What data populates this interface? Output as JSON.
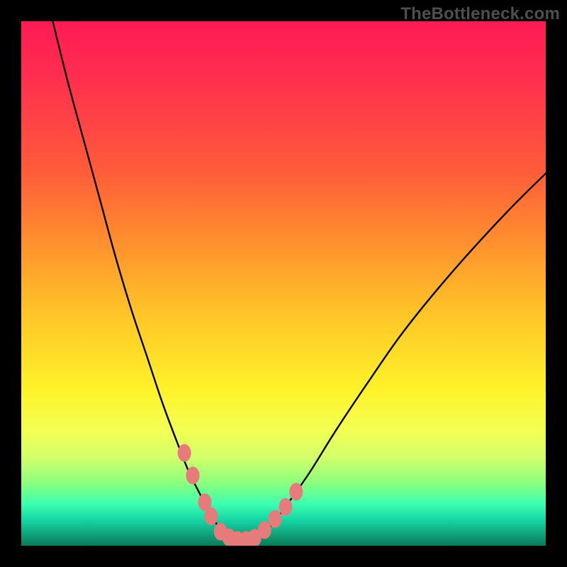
{
  "watermark": "TheBottleneck.com",
  "chart_data": {
    "type": "line",
    "title": "",
    "xlabel": "",
    "ylabel": "",
    "xlim": [
      0,
      100
    ],
    "ylim": [
      0,
      100
    ],
    "grid": false,
    "legend": false,
    "series": [
      {
        "name": "bottleneck-curve",
        "color": "#000000",
        "x": [
          6,
          9,
          12,
          15,
          18,
          21,
          24,
          27,
          30,
          32,
          34,
          35.5,
          37,
          38.5,
          40,
          42,
          44,
          46,
          48,
          51,
          55,
          60,
          66,
          73,
          82,
          92,
          100
        ],
        "y": [
          100,
          88,
          77,
          66,
          55,
          45,
          36,
          27,
          19,
          14,
          10,
          7,
          4.5,
          2.7,
          1.6,
          1.0,
          1.2,
          2.3,
          4.3,
          8.3,
          14,
          22,
          31,
          41,
          52,
          63,
          71
        ]
      }
    ],
    "markers": [
      {
        "name": "dot-left-upper",
        "x": 31.1,
        "y": 17.7,
        "color": "#e77b7b"
      },
      {
        "name": "dot-left-mid",
        "x": 32.7,
        "y": 13.4,
        "color": "#e77b7b"
      },
      {
        "name": "dot-left-low1",
        "x": 35.0,
        "y": 8.3,
        "color": "#e77b7b"
      },
      {
        "name": "dot-left-low2",
        "x": 36.2,
        "y": 5.6,
        "color": "#e77b7b"
      },
      {
        "name": "dot-bottom-1",
        "x": 38.0,
        "y": 2.7,
        "color": "#e77b7b"
      },
      {
        "name": "dot-bottom-2",
        "x": 39.6,
        "y": 1.6,
        "color": "#e77b7b"
      },
      {
        "name": "dot-bottom-3",
        "x": 41.2,
        "y": 1.1,
        "color": "#e77b7b"
      },
      {
        "name": "dot-bottom-4",
        "x": 42.9,
        "y": 1.1,
        "color": "#e77b7b"
      },
      {
        "name": "dot-bottom-5",
        "x": 44.5,
        "y": 1.5,
        "color": "#e77b7b"
      },
      {
        "name": "dot-right-low1",
        "x": 46.4,
        "y": 3.0,
        "color": "#e77b7b"
      },
      {
        "name": "dot-right-low2",
        "x": 48.4,
        "y": 5.1,
        "color": "#e77b7b"
      },
      {
        "name": "dot-right-mid",
        "x": 50.4,
        "y": 7.4,
        "color": "#e77b7b"
      },
      {
        "name": "dot-right-upper",
        "x": 52.4,
        "y": 10.3,
        "color": "#e77b7b"
      }
    ],
    "background_gradient": {
      "direction": "top-to-bottom",
      "stops": [
        {
          "pos": 0.0,
          "color": "#ff1b55"
        },
        {
          "pos": 0.28,
          "color": "#ff5a3a"
        },
        {
          "pos": 0.55,
          "color": "#ffc228"
        },
        {
          "pos": 0.7,
          "color": "#fff229"
        },
        {
          "pos": 0.88,
          "color": "#8cff7e"
        },
        {
          "pos": 0.95,
          "color": "#16d7a6"
        },
        {
          "pos": 1.0,
          "color": "#0a7a5a"
        }
      ]
    }
  }
}
